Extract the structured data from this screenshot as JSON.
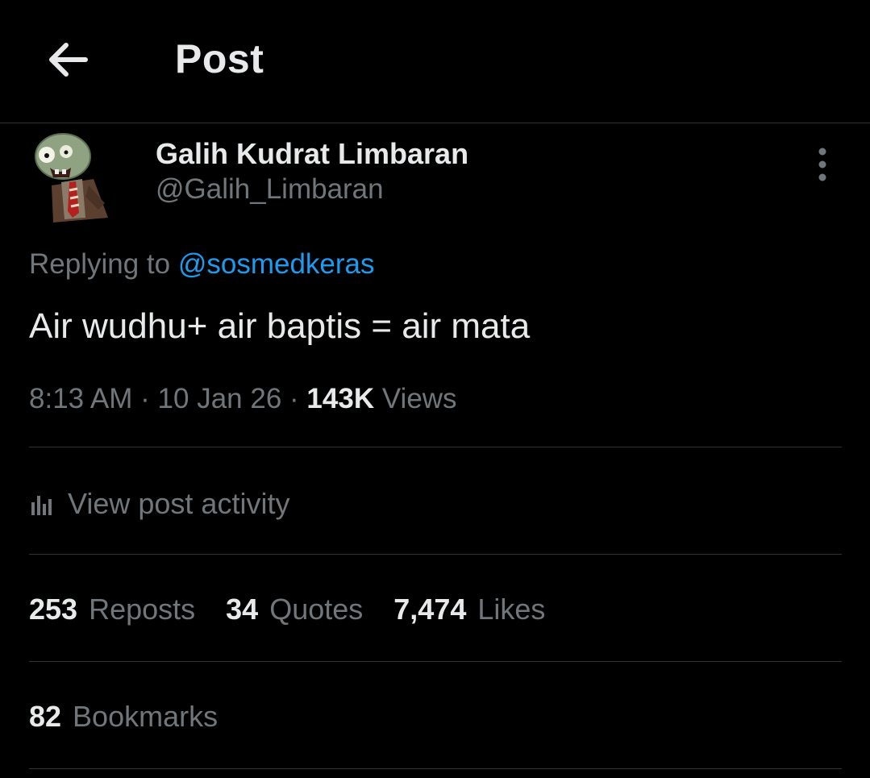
{
  "header": {
    "title": "Post",
    "back_icon": "arrow-left-icon"
  },
  "author": {
    "display_name": "Galih Kudrat Limbaran",
    "handle": "@Galih_Limbaran",
    "avatar": "zombie-avatar"
  },
  "reply": {
    "prefix": "Replying to",
    "mention": "@sosmedkeras"
  },
  "post": {
    "text": "Air wudhu+ air baptis = air mata"
  },
  "meta": {
    "time": "8:13 AM",
    "sep": "·",
    "date": "10 Jan 26",
    "views_count": "143K",
    "views_label": "Views"
  },
  "activity": {
    "label": "View post activity",
    "icon": "analytics-icon"
  },
  "stats": {
    "reposts_count": "253",
    "reposts_label": "Reposts",
    "quotes_count": "34",
    "quotes_label": "Quotes",
    "likes_count": "7,474",
    "likes_label": "Likes",
    "bookmarks_count": "82",
    "bookmarks_label": "Bookmarks"
  },
  "colors": {
    "background": "#000000",
    "primary_text": "#e7e9ea",
    "secondary_text": "#71767b",
    "link": "#1d9bf0",
    "divider": "#2f3336"
  }
}
